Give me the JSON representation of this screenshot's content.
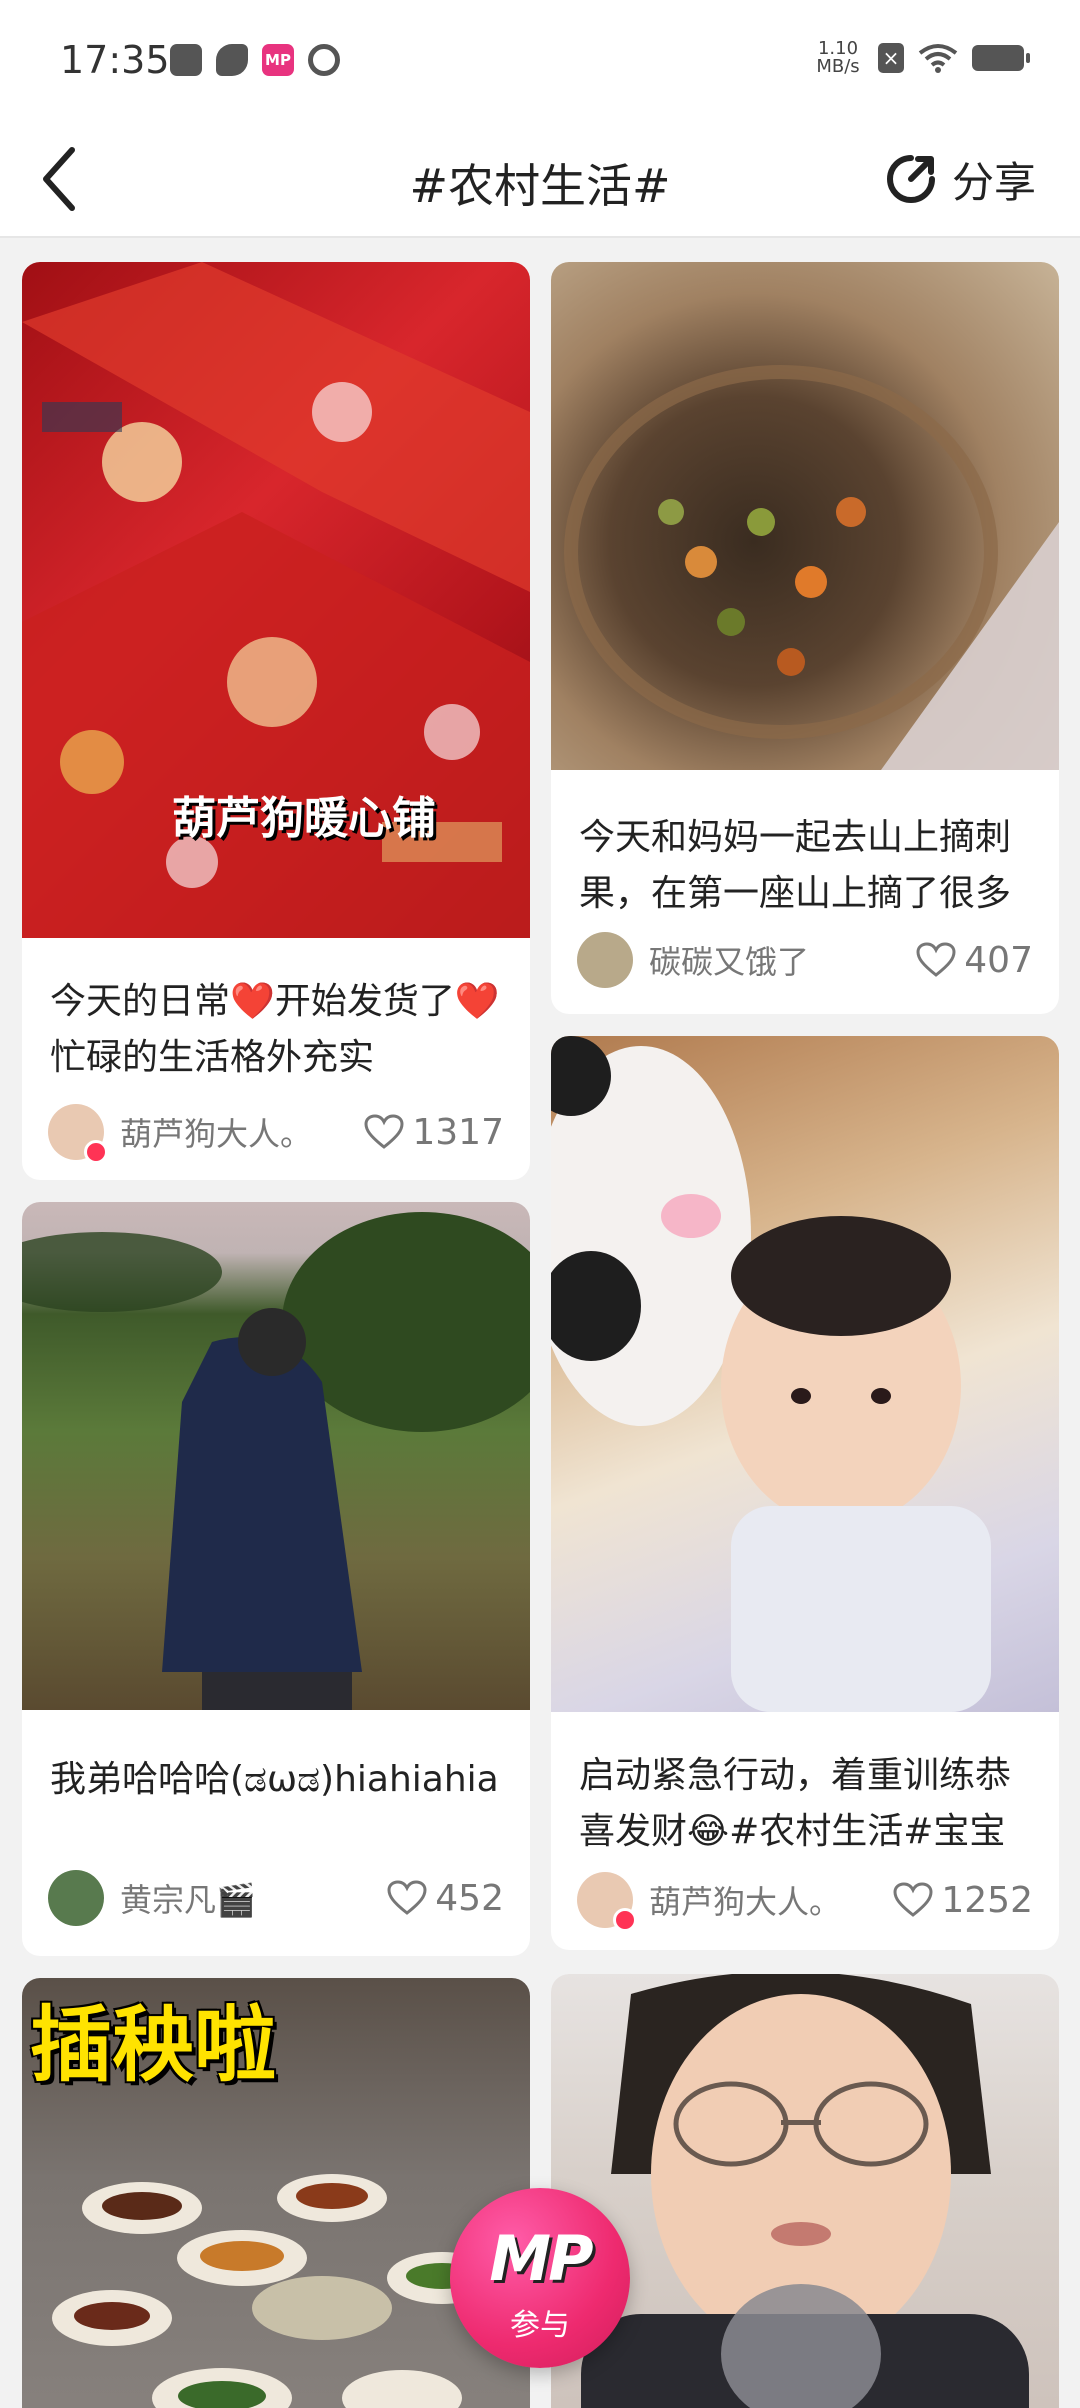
{
  "status_bar": {
    "time": "17:35",
    "app_icon_mp": "MP",
    "net_speed_value": "1.10",
    "net_speed_unit": "MB/s",
    "notif_x": "×"
  },
  "header": {
    "title": "#农村生活#",
    "share_label": "分享"
  },
  "feed": [
    {
      "caption": "今天的日常❤️开始发货了❤️忙碌的生活格外充实",
      "author": "葫芦狗大人。",
      "likes": "1317",
      "thumb_text": "葫芦狗暖心铺",
      "verified": true,
      "colors": {
        "thumb": "#c4161c",
        "avatar": "#e9c9b2"
      }
    },
    {
      "caption": "今天和妈妈一起去山上摘刺果，在第一座山上摘了很多",
      "author": "碳碳又饿了",
      "likes": "407",
      "verified": false,
      "colors": {
        "thumb": "#7a5a3a",
        "avatar": "#b8a98a"
      }
    },
    {
      "caption": "我弟哈哈哈(ಡωಡ)hiahiahia",
      "author": "黄宗凡🎬",
      "likes": "452",
      "verified": false,
      "colors": {
        "thumb": "#4f6a3c",
        "avatar": "#587a4e"
      }
    },
    {
      "caption": "启动紧急行动，着重训练恭喜发财😂#农村生活#宝宝",
      "author": "葫芦狗大人。",
      "likes": "1252",
      "verified": true,
      "colors": {
        "thumb": "#c59b72",
        "avatar": "#e9c9b2"
      }
    },
    {
      "thumb_text": "插秧啦",
      "colors": {
        "thumb": "#6e6a66"
      }
    },
    {
      "colors": {
        "thumb": "#cfcac7"
      }
    }
  ],
  "fab": {
    "logo": "MP",
    "label": "参与"
  }
}
